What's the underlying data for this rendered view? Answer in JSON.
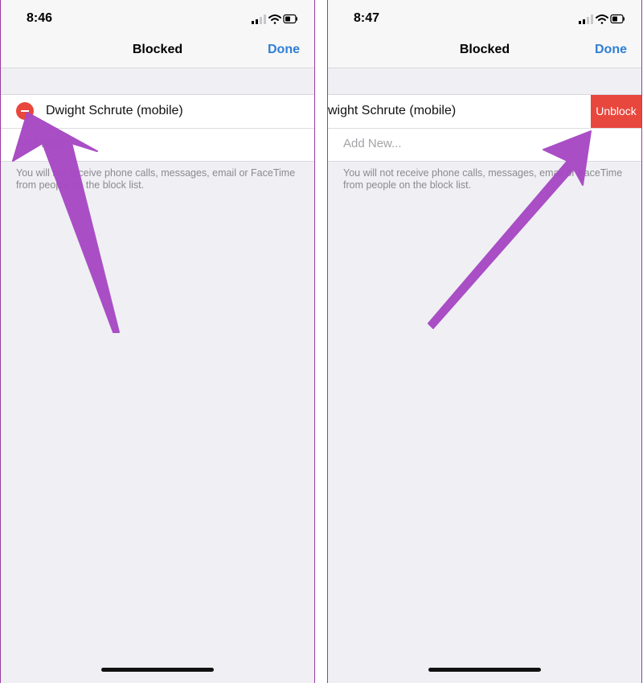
{
  "left": {
    "status": {
      "time": "8:46"
    },
    "nav": {
      "title": "Blocked",
      "done": "Done"
    },
    "blocked_entry": {
      "name": "Dwight Schrute (mobile)"
    },
    "add_new": "Add New...",
    "note": "You will not receive phone calls, messages, email or FaceTime from people on the block list."
  },
  "right": {
    "status": {
      "time": "8:47"
    },
    "nav": {
      "title": "Blocked",
      "done": "Done"
    },
    "blocked_entry": {
      "name": "wight Schrute (mobile)",
      "unblock": "Unblock"
    },
    "add_new": "Add New...",
    "note": "You will not receive phone calls, messages, email or FaceTime from people on the block list."
  },
  "colors": {
    "accent": "#2f7fd6",
    "destructive": "#e8473d",
    "annotation_arrow": "#a749c4",
    "background": "#efeff4"
  },
  "icons": [
    "signal-icon",
    "wifi-icon",
    "battery-icon",
    "minus-circle-icon",
    "annotation-arrow"
  ]
}
